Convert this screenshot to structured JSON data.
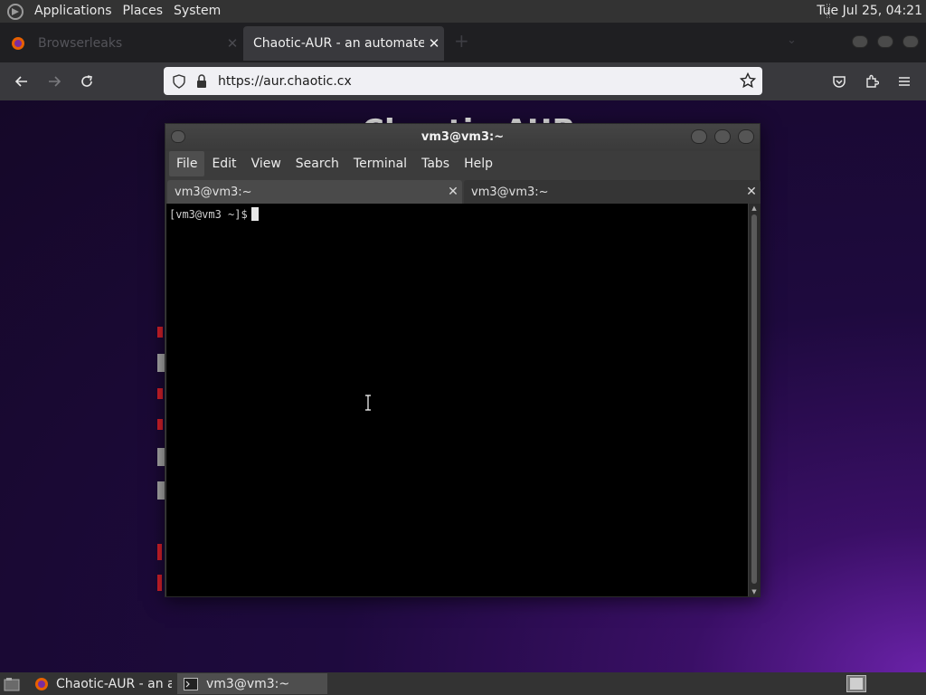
{
  "top_panel": {
    "menu": [
      "Applications",
      "Places",
      "System"
    ],
    "clock": "Tue Jul 25, 04:21"
  },
  "browser": {
    "tabs": [
      {
        "title": "Browserleaks",
        "active": false
      },
      {
        "title": "Chaotic-AUR - an automated bu",
        "active": true
      }
    ],
    "url": "https://aur.chaotic.cx",
    "page_title": "Chaotic-AUR"
  },
  "terminal": {
    "window_title": "vm3@vm3:~",
    "menu": [
      "File",
      "Edit",
      "View",
      "Search",
      "Terminal",
      "Tabs",
      "Help"
    ],
    "tabs": [
      "vm3@vm3:~",
      "vm3@vm3:~"
    ],
    "prompt": "[vm3@vm3 ~]$"
  },
  "taskbar": {
    "items": [
      "Chaotic-AUR - an au...",
      "vm3@vm3:~"
    ]
  },
  "colors": {
    "panel": "#333333",
    "browser_chrome": "#39393d",
    "page_bg": "#1e0a3e",
    "accent_red": "#d4202a"
  }
}
